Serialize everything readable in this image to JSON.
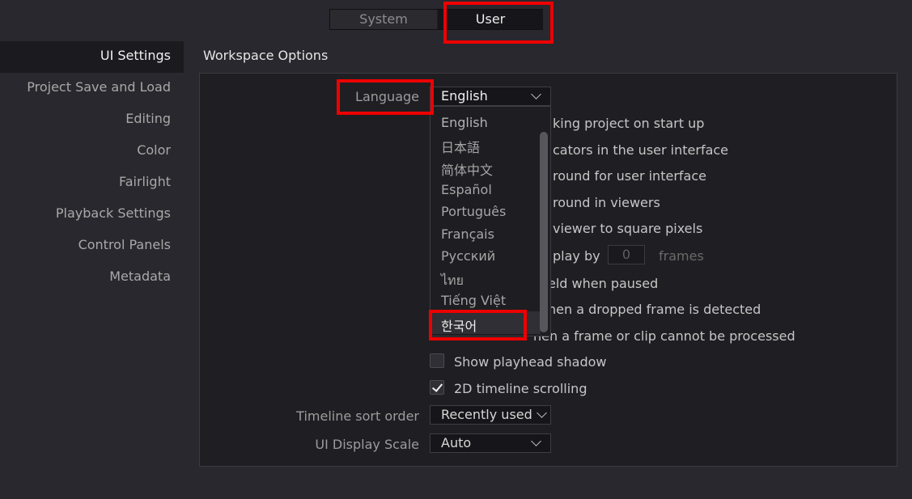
{
  "tabs": {
    "system": "System",
    "user": "User"
  },
  "sidebar": {
    "items": [
      {
        "label": "UI Settings"
      },
      {
        "label": "Project Save and Load"
      },
      {
        "label": "Editing"
      },
      {
        "label": "Color"
      },
      {
        "label": "Fairlight"
      },
      {
        "label": "Playback Settings"
      },
      {
        "label": "Control Panels"
      },
      {
        "label": "Metadata"
      }
    ]
  },
  "workspace": {
    "title": "Workspace Options",
    "language_label": "Language",
    "language_value": "English",
    "options": [
      {
        "text": "king project on start up"
      },
      {
        "text": "cators in the user interface"
      },
      {
        "text": "round for user interface"
      },
      {
        "text": "round in viewers"
      },
      {
        "text": "viewer to square pixels"
      },
      {
        "text": "play by"
      },
      {
        "text": "eld when paused"
      },
      {
        "text": "hen a dropped frame is detected"
      },
      {
        "text": "hen a frame or clip cannot be processed"
      },
      {
        "text": "Show playhead shadow",
        "checked": false
      },
      {
        "text": "2D timeline scrolling",
        "checked": true
      }
    ],
    "frames_value": "0",
    "frames_unit": "frames",
    "timeline_sort_label": "Timeline sort order",
    "timeline_sort_value": "Recently used",
    "ui_scale_label": "UI Display Scale",
    "ui_scale_value": "Auto"
  },
  "language_dropdown": {
    "options": [
      "English",
      "日本語",
      "简体中文",
      "Español",
      "Português",
      "Français",
      "Русский",
      "ไทย",
      "Tiếng Việt",
      "한국어"
    ],
    "highlighted": "한국어"
  },
  "colors": {
    "background": "#28282e",
    "panel": "#1f1f23",
    "highlight_box": "#ee0000"
  }
}
